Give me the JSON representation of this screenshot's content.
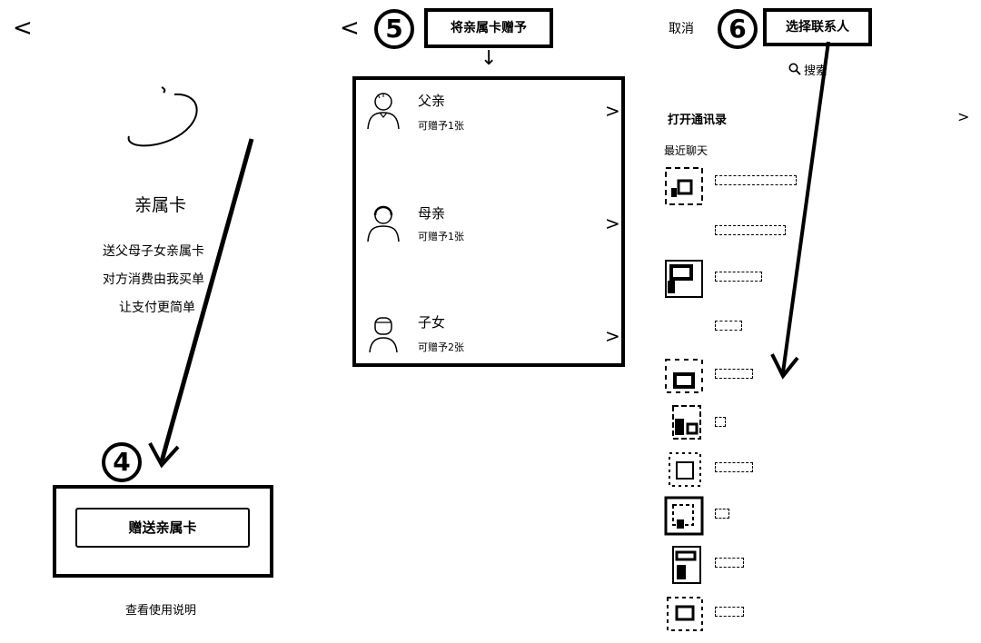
{
  "panel1": {
    "back_glyph": "<",
    "card_title": "亲属卡",
    "desc_lines": [
      "送父母子女亲属卡",
      "对方消费由我买单",
      "让支付更简单"
    ],
    "step_number": "4",
    "gift_button_label": "赠送亲属卡",
    "usage_link": "查看使用说明"
  },
  "panel2": {
    "back_glyph": "<",
    "step_number": "5",
    "title": "将亲属卡赠予",
    "arrow_down": "↓",
    "recipients": [
      {
        "name": "父亲",
        "sub": "可赠予1张",
        "chevron": ">",
        "icon": "father-avatar-icon"
      },
      {
        "name": "母亲",
        "sub": "可赠予1张",
        "chevron": ">",
        "icon": "mother-avatar-icon"
      },
      {
        "name": "子女",
        "sub": "可赠予2张",
        "chevron": ">",
        "icon": "child-avatar-icon"
      }
    ]
  },
  "panel3": {
    "cancel_label": "取消",
    "step_number": "6",
    "title": "选择联系人",
    "search_label": "搜索",
    "open_contacts_label": "打开通讯录",
    "open_contacts_chevron": ">",
    "recent_chats_label": "最近聊天"
  }
}
